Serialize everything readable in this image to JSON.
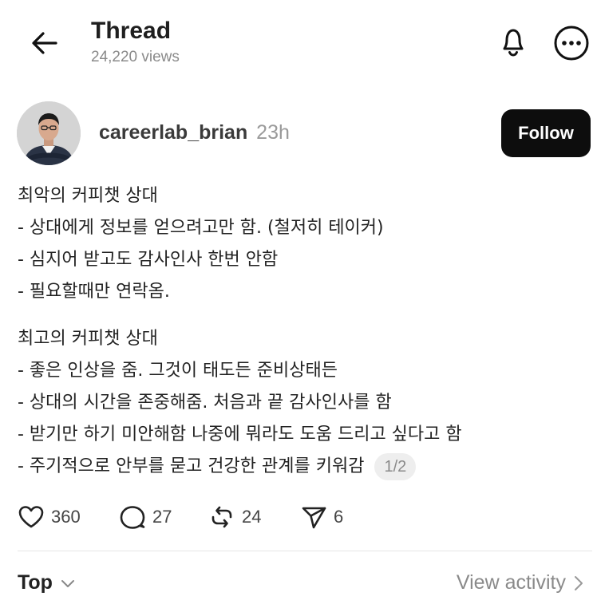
{
  "header": {
    "title": "Thread",
    "views": "24,220 views"
  },
  "post": {
    "author": {
      "username": "careerlab_brian",
      "time": "23h"
    },
    "follow_label": "Follow",
    "paragraphs": [
      [
        "최악의 커피챗 상대",
        "- 상대에게 정보를 얻으려고만 함. (철저히 테이커)",
        "- 심지어 받고도 감사인사 한번 안함",
        "- 필요할때만 연락옴."
      ],
      [
        "최고의 커피챗 상대",
        "- 좋은 인상을 줌. 그것이 태도든 준비상태든",
        "- 상대의 시간을 존중해줌. 처음과 끝 감사인사를 함",
        "- 받기만 하기 미안해함 나중에 뭐라도 도움 드리고 싶다고 함",
        "- 주기적으로 안부를 묻고 건강한 관계를 키워감"
      ]
    ],
    "page_indicator": "1/2",
    "actions": {
      "likes": "360",
      "replies": "27",
      "reposts": "24",
      "shares": "6"
    }
  },
  "footer": {
    "sort_label": "Top",
    "view_activity_label": "View activity"
  },
  "icons": {
    "back": "arrow-left-icon",
    "notifications": "bell-icon",
    "more": "more-icon",
    "like": "heart-icon",
    "reply": "comment-icon",
    "repost": "repost-icon",
    "share": "send-icon"
  },
  "colors": {
    "follow_bg": "#0d0d0d",
    "muted_text": "#8a8a8a"
  }
}
